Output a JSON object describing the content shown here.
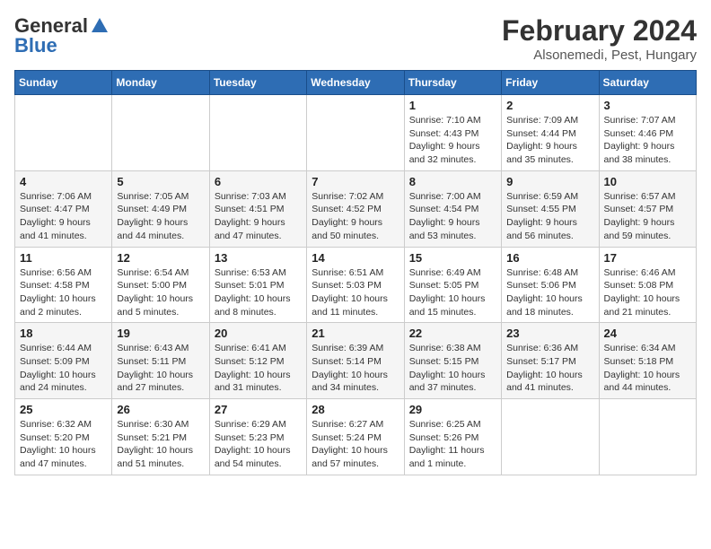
{
  "logo": {
    "general": "General",
    "blue": "Blue"
  },
  "header": {
    "title": "February 2024",
    "subtitle": "Alsonemedi, Pest, Hungary"
  },
  "calendar": {
    "days_of_week": [
      "Sunday",
      "Monday",
      "Tuesday",
      "Wednesday",
      "Thursday",
      "Friday",
      "Saturday"
    ],
    "weeks": [
      [
        {
          "day": "",
          "info": ""
        },
        {
          "day": "",
          "info": ""
        },
        {
          "day": "",
          "info": ""
        },
        {
          "day": "",
          "info": ""
        },
        {
          "day": "1",
          "info": "Sunrise: 7:10 AM\nSunset: 4:43 PM\nDaylight: 9 hours\nand 32 minutes."
        },
        {
          "day": "2",
          "info": "Sunrise: 7:09 AM\nSunset: 4:44 PM\nDaylight: 9 hours\nand 35 minutes."
        },
        {
          "day": "3",
          "info": "Sunrise: 7:07 AM\nSunset: 4:46 PM\nDaylight: 9 hours\nand 38 minutes."
        }
      ],
      [
        {
          "day": "4",
          "info": "Sunrise: 7:06 AM\nSunset: 4:47 PM\nDaylight: 9 hours\nand 41 minutes."
        },
        {
          "day": "5",
          "info": "Sunrise: 7:05 AM\nSunset: 4:49 PM\nDaylight: 9 hours\nand 44 minutes."
        },
        {
          "day": "6",
          "info": "Sunrise: 7:03 AM\nSunset: 4:51 PM\nDaylight: 9 hours\nand 47 minutes."
        },
        {
          "day": "7",
          "info": "Sunrise: 7:02 AM\nSunset: 4:52 PM\nDaylight: 9 hours\nand 50 minutes."
        },
        {
          "day": "8",
          "info": "Sunrise: 7:00 AM\nSunset: 4:54 PM\nDaylight: 9 hours\nand 53 minutes."
        },
        {
          "day": "9",
          "info": "Sunrise: 6:59 AM\nSunset: 4:55 PM\nDaylight: 9 hours\nand 56 minutes."
        },
        {
          "day": "10",
          "info": "Sunrise: 6:57 AM\nSunset: 4:57 PM\nDaylight: 9 hours\nand 59 minutes."
        }
      ],
      [
        {
          "day": "11",
          "info": "Sunrise: 6:56 AM\nSunset: 4:58 PM\nDaylight: 10 hours\nand 2 minutes."
        },
        {
          "day": "12",
          "info": "Sunrise: 6:54 AM\nSunset: 5:00 PM\nDaylight: 10 hours\nand 5 minutes."
        },
        {
          "day": "13",
          "info": "Sunrise: 6:53 AM\nSunset: 5:01 PM\nDaylight: 10 hours\nand 8 minutes."
        },
        {
          "day": "14",
          "info": "Sunrise: 6:51 AM\nSunset: 5:03 PM\nDaylight: 10 hours\nand 11 minutes."
        },
        {
          "day": "15",
          "info": "Sunrise: 6:49 AM\nSunset: 5:05 PM\nDaylight: 10 hours\nand 15 minutes."
        },
        {
          "day": "16",
          "info": "Sunrise: 6:48 AM\nSunset: 5:06 PM\nDaylight: 10 hours\nand 18 minutes."
        },
        {
          "day": "17",
          "info": "Sunrise: 6:46 AM\nSunset: 5:08 PM\nDaylight: 10 hours\nand 21 minutes."
        }
      ],
      [
        {
          "day": "18",
          "info": "Sunrise: 6:44 AM\nSunset: 5:09 PM\nDaylight: 10 hours\nand 24 minutes."
        },
        {
          "day": "19",
          "info": "Sunrise: 6:43 AM\nSunset: 5:11 PM\nDaylight: 10 hours\nand 27 minutes."
        },
        {
          "day": "20",
          "info": "Sunrise: 6:41 AM\nSunset: 5:12 PM\nDaylight: 10 hours\nand 31 minutes."
        },
        {
          "day": "21",
          "info": "Sunrise: 6:39 AM\nSunset: 5:14 PM\nDaylight: 10 hours\nand 34 minutes."
        },
        {
          "day": "22",
          "info": "Sunrise: 6:38 AM\nSunset: 5:15 PM\nDaylight: 10 hours\nand 37 minutes."
        },
        {
          "day": "23",
          "info": "Sunrise: 6:36 AM\nSunset: 5:17 PM\nDaylight: 10 hours\nand 41 minutes."
        },
        {
          "day": "24",
          "info": "Sunrise: 6:34 AM\nSunset: 5:18 PM\nDaylight: 10 hours\nand 44 minutes."
        }
      ],
      [
        {
          "day": "25",
          "info": "Sunrise: 6:32 AM\nSunset: 5:20 PM\nDaylight: 10 hours\nand 47 minutes."
        },
        {
          "day": "26",
          "info": "Sunrise: 6:30 AM\nSunset: 5:21 PM\nDaylight: 10 hours\nand 51 minutes."
        },
        {
          "day": "27",
          "info": "Sunrise: 6:29 AM\nSunset: 5:23 PM\nDaylight: 10 hours\nand 54 minutes."
        },
        {
          "day": "28",
          "info": "Sunrise: 6:27 AM\nSunset: 5:24 PM\nDaylight: 10 hours\nand 57 minutes."
        },
        {
          "day": "29",
          "info": "Sunrise: 6:25 AM\nSunset: 5:26 PM\nDaylight: 11 hours\nand 1 minute."
        },
        {
          "day": "",
          "info": ""
        },
        {
          "day": "",
          "info": ""
        }
      ]
    ]
  }
}
